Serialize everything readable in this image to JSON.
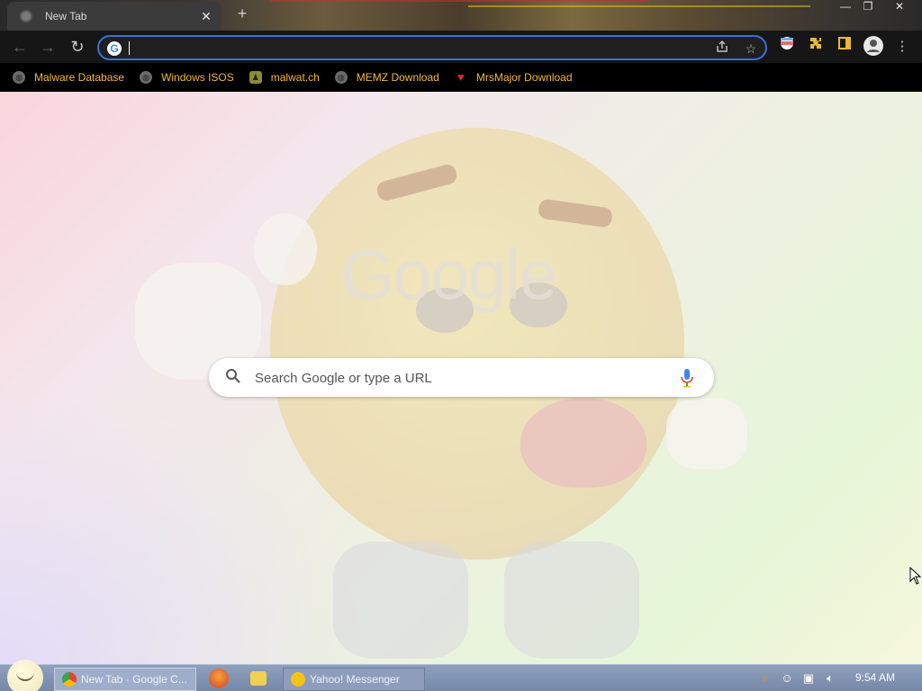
{
  "browser": {
    "tab": {
      "title": "New Tab",
      "close": "✕"
    },
    "new_tab_symbol": "+",
    "window_controls": {
      "minimize": "—",
      "maximize": "❐",
      "close": "✕"
    },
    "nav": {
      "back": "←",
      "forward": "→",
      "reload": "↻"
    },
    "omnibox": {
      "value": "",
      "icon": "google-g-icon",
      "share_icon": "share-icon",
      "bookmark_icon": "star-icon"
    },
    "toolbar_icons": [
      "profile-avatar-badge-icon",
      "extensions-icon",
      "side-panel-icon",
      "account-icon",
      "menu-icon"
    ]
  },
  "bookmarks": [
    {
      "label": "Malware Database",
      "icon": "globe-icon"
    },
    {
      "label": "Windows ISOS",
      "icon": "globe-icon"
    },
    {
      "label": "malwat.ch",
      "icon": "person-icon"
    },
    {
      "label": "MEMZ Download",
      "icon": "globe-icon"
    },
    {
      "label": "MrsMajor Download",
      "icon": "heart-icon"
    }
  ],
  "new_tab_page": {
    "logo_text": "Google",
    "search_placeholder": "Search Google or type a URL"
  },
  "taskbar": {
    "items": [
      {
        "label": "New Tab - Google C...",
        "icon": "chrome-icon",
        "active": true
      },
      {
        "label": "Yahoo! Messenger",
        "icon": "yahoo-smiley-icon",
        "active": false
      }
    ],
    "quick_launch": [
      "firefox-icon",
      "folder-icon"
    ],
    "tray": [
      "search-icon",
      "messenger-icon",
      "network-icon",
      "volume-icon"
    ],
    "clock": "9:54 AM"
  },
  "colors": {
    "bookmark_text": "#f4b73a",
    "omnibox_focus": "#3b6fd9",
    "taskbar": "#7f91b1"
  }
}
